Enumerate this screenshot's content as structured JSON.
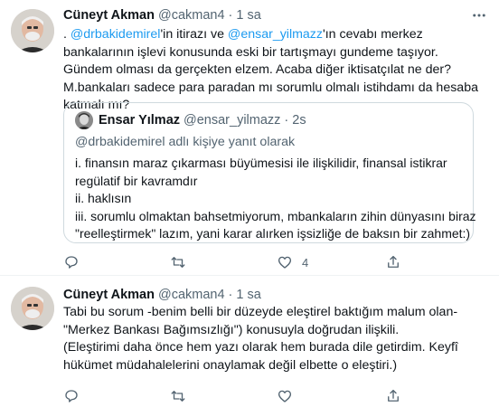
{
  "tweets": [
    {
      "author": {
        "name": "Cüneyt Akman",
        "handle": "@cakman4",
        "separator": "·",
        "time": "1 sa"
      },
      "more_icon": "more-dots-icon",
      "text_parts": {
        "prefix": ". ",
        "mention1": "@drbakidemirel",
        "mid1": "'in itirazı ve ",
        "mention2": "@ensar_yilmazz",
        "rest": "'ın cevabı merkez bankalarının işlevi konusunda eski bir tartışmayı gundeme taşıyor. Gündem olması da gerçekten elzem. Acaba diğer iktisatçılat ne der? M.bankaları sadece para paradan mı sorumlu olmalı istihdamı da hesaba katmalı mı?"
      },
      "quote": {
        "name": "Ensar Yılmaz",
        "handle": "@ensar_yilmazz",
        "separator": "·",
        "time": "2s",
        "reply_to": "@drbakidemirel adlı kişiye yanıt olarak",
        "lines": [
          "i. finansın maraz çıkarması büyümesisi ile ilişkilidir, finansal istikrar",
          "regülatif bir kavramdır",
          "ii. haklısın",
          "iii. sorumlu olmaktan bahsetmiyorum, mbankaların zihin dünyasını biraz",
          "\"reelleştirmek\" lazım, yani karar alırken işsizliğe de baksın bir zahmet:)"
        ]
      },
      "actions": {
        "reply_count": "",
        "retweet_count": "",
        "like_count": "4"
      }
    },
    {
      "author": {
        "name": "Cüneyt Akman",
        "handle": "@cakman4",
        "separator": "·",
        "time": "1 sa"
      },
      "text_lines": [
        "Tabi bu sorum -benim belli bir düzeyde eleştirel baktığım malum olan-",
        "\"Merkez Bankası Bağımsızlığı\") konusuyla doğrudan ilişkili.",
        "(Eleştirimi daha önce hem yazı olarak hem burada dile getirdim. Keyfî",
        "hükümet müdahalelerini onaylamak değil elbette o eleştiri.)"
      ],
      "actions": {
        "reply_count": "",
        "retweet_count": "",
        "like_count": ""
      }
    }
  ],
  "colors": {
    "text": "#0f1419",
    "secondary": "#536471",
    "link": "#1d9bf0",
    "border": "#cfd9de",
    "divider": "#eff3f4"
  },
  "icons": [
    "avatar-photo",
    "more-dots-icon",
    "reply-icon",
    "retweet-icon",
    "like-icon",
    "share-icon"
  ]
}
